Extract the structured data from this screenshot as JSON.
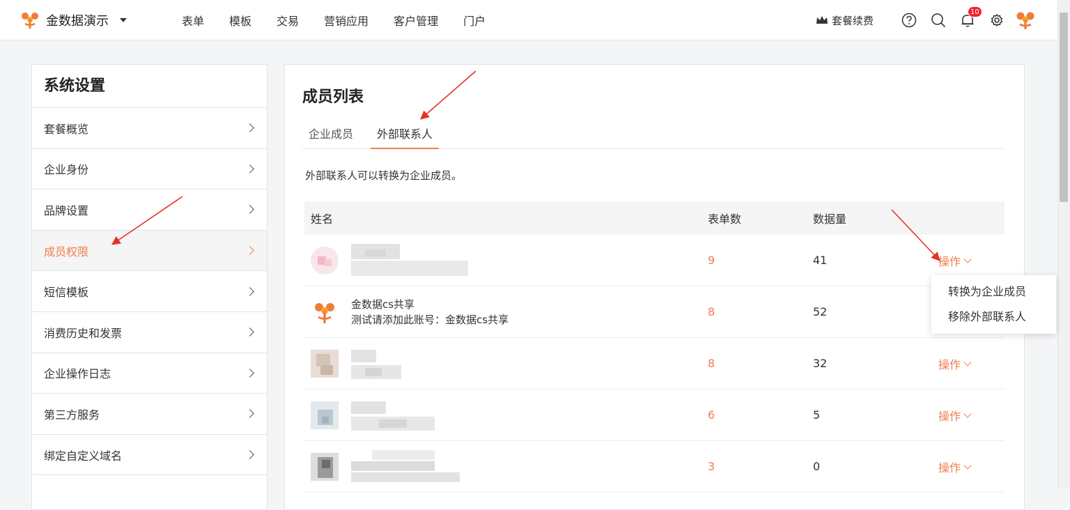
{
  "header": {
    "app_name": "金数据演示",
    "nav": [
      "表单",
      "模板",
      "交易",
      "营销应用",
      "客户管理",
      "门户"
    ],
    "renew_label": "套餐续费",
    "notification_count": "10"
  },
  "sidebar": {
    "title": "系统设置",
    "items": [
      {
        "label": "套餐概览"
      },
      {
        "label": "企业身份"
      },
      {
        "label": "品牌设置"
      },
      {
        "label": "成员权限",
        "active": true
      },
      {
        "label": "短信模板"
      },
      {
        "label": "消费历史和发票"
      },
      {
        "label": "企业操作日志"
      },
      {
        "label": "第三方服务"
      },
      {
        "label": "绑定自定义域名"
      }
    ]
  },
  "main": {
    "title": "成员列表",
    "tabs": [
      {
        "label": "企业成员"
      },
      {
        "label": "外部联系人",
        "active": true
      }
    ],
    "hint": "外部联系人可以转换为企业成员。",
    "table": {
      "headers": {
        "name": "姓名",
        "forms": "表单数",
        "data": "数据量"
      },
      "op_label": "操作",
      "rows": [
        {
          "name": "",
          "sub": "",
          "forms": "9",
          "data": "41",
          "blurred": true
        },
        {
          "name": "金数据cs共享",
          "sub": "测试请添加此账号：金数据cs共享",
          "forms": "8",
          "data": "52",
          "blurred": false
        },
        {
          "name": "",
          "sub": "",
          "forms": "8",
          "data": "32",
          "blurred": true
        },
        {
          "name": "",
          "sub": "",
          "forms": "6",
          "data": "5",
          "blurred": true
        },
        {
          "name": "",
          "sub": "",
          "forms": "3",
          "data": "0",
          "blurred": true
        }
      ]
    }
  },
  "dropdown": {
    "items": [
      "转换为企业成员",
      "移除外部联系人"
    ]
  },
  "colors": {
    "accent": "#f07c4e",
    "annotation_arrow": "#e8302a"
  }
}
